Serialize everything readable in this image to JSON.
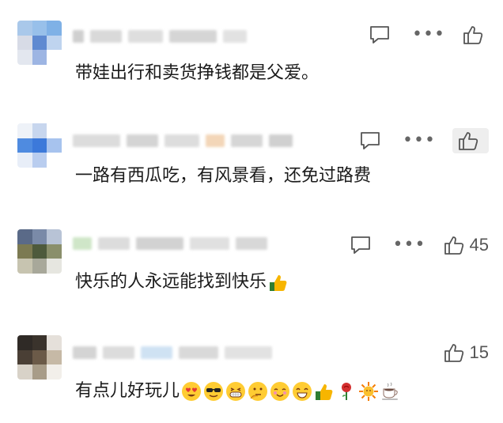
{
  "comments": [
    {
      "text": "带娃出行和卖货挣钱都是父爱。",
      "like_count": ""
    },
    {
      "text": "一路有西瓜吃，有风景看，还免过路费",
      "like_count": ""
    },
    {
      "text": "快乐的人永远能找到快乐",
      "like_count": "45",
      "emojis": [
        "thumbs-up-emoji"
      ]
    },
    {
      "text": "有点儿好玩儿",
      "like_count": "15",
      "emojis": [
        "heart-eyes-emoji",
        "sunglasses-emoji",
        "grin-emoji",
        "thinking-emoji",
        "blush-emoji",
        "laughing-emoji",
        "thumbs-up-emoji",
        "rose-emoji",
        "sun-emoji",
        "coffee-emoji"
      ]
    }
  ],
  "icons": {
    "reply": "comment-bubble-icon",
    "more": "more-dots-icon",
    "like": "thumbs-up-icon"
  }
}
